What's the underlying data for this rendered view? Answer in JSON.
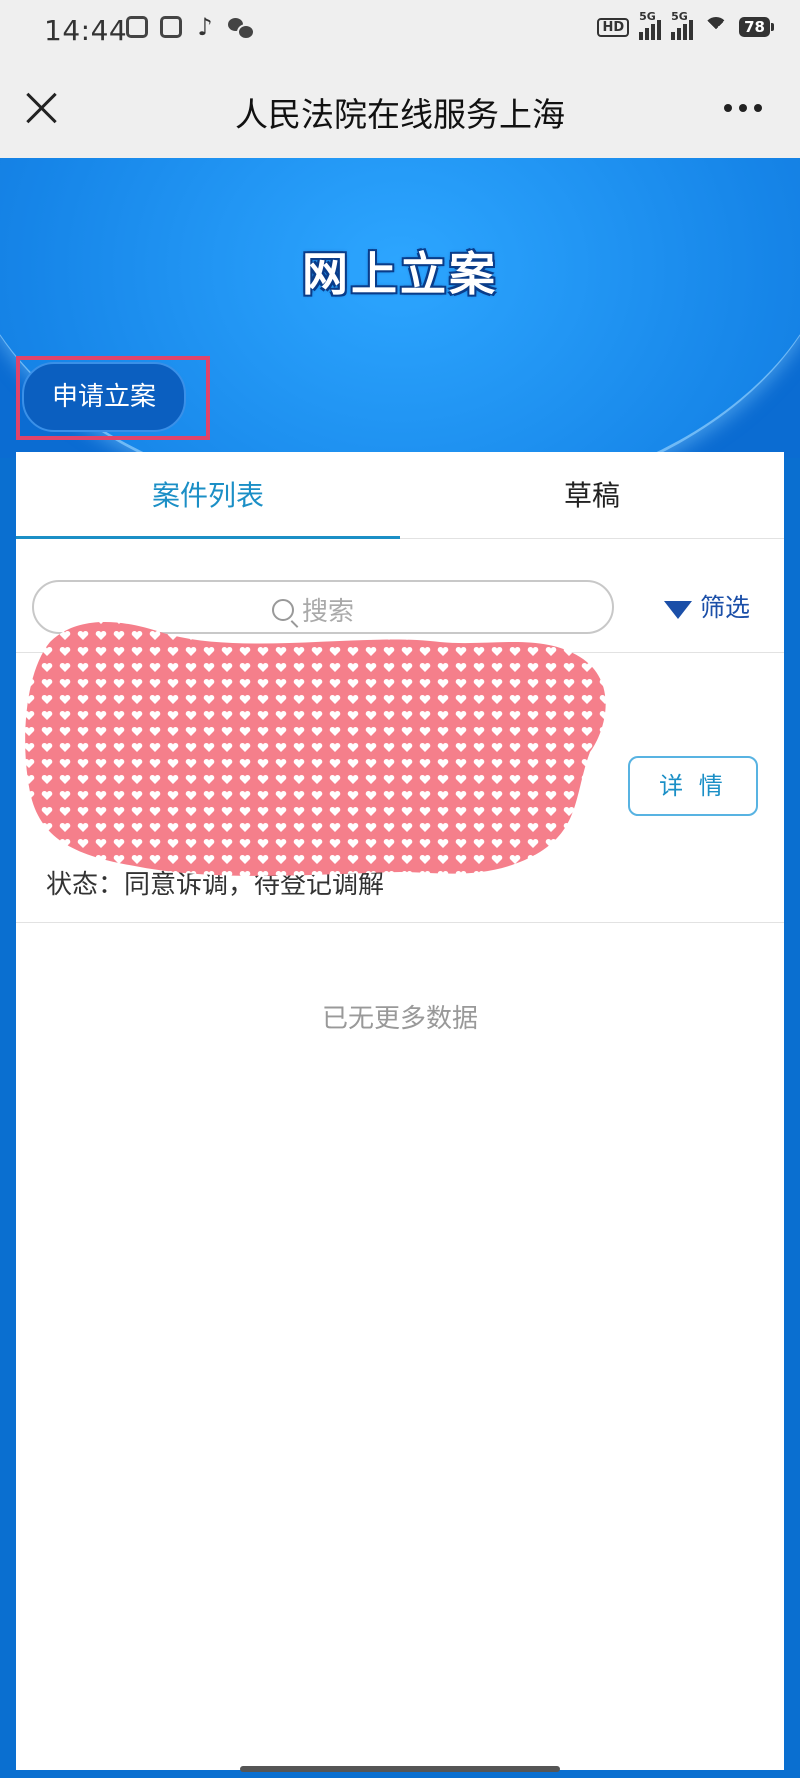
{
  "status_bar": {
    "time": "14:44",
    "hd": "HD",
    "signal1": "5G",
    "signal2": "5G",
    "battery": "78"
  },
  "header": {
    "title": "人民法院在线服务上海"
  },
  "banner": {
    "title": "网上立案",
    "apply_button": "申请立案"
  },
  "tabs": [
    {
      "label": "案件列表",
      "active": true
    },
    {
      "label": "草稿",
      "active": false
    }
  ],
  "search": {
    "placeholder": "搜索"
  },
  "filter": {
    "label": "筛选"
  },
  "case_card": {
    "detail_button": "详 情",
    "status": "状态：同意诉调，待登记调解"
  },
  "list_footer": "已无更多数据",
  "colors": {
    "accent": "#1b8fc6",
    "banner_blue": "#0b6cd2",
    "highlight_border": "#e0446b",
    "redaction": "#f57f8b"
  }
}
